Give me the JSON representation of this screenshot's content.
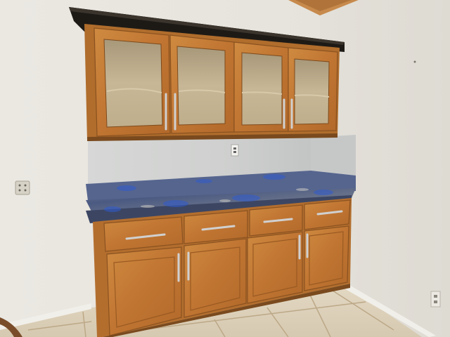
{
  "scene": {
    "subject": "kitchen-built-in-hutch",
    "palette": {
      "wall": "#e8e5df",
      "wall_right": "#e4e1da",
      "cabinet_wood": "#c37a33",
      "cabinet_dark": "#9a5a22",
      "crown_molding": "#1d1a16",
      "glass": "#b8a98c",
      "backsplash": "#cfd0cf",
      "granite": "#5d6a86",
      "granite_blue": "#3b56a6",
      "floor_tile": "#ddd1bb",
      "grout": "#bfae92",
      "handle": "#c9c9c9"
    }
  },
  "upper_cabinets": [
    {
      "door": 1,
      "glass": "textured"
    },
    {
      "door": 2,
      "glass": "textured"
    },
    {
      "door": 3,
      "glass": "textured"
    },
    {
      "door": 4,
      "glass": "textured"
    }
  ],
  "drawers": [
    1,
    2,
    3,
    4
  ],
  "lower_doors": [
    1,
    2,
    3,
    4
  ]
}
